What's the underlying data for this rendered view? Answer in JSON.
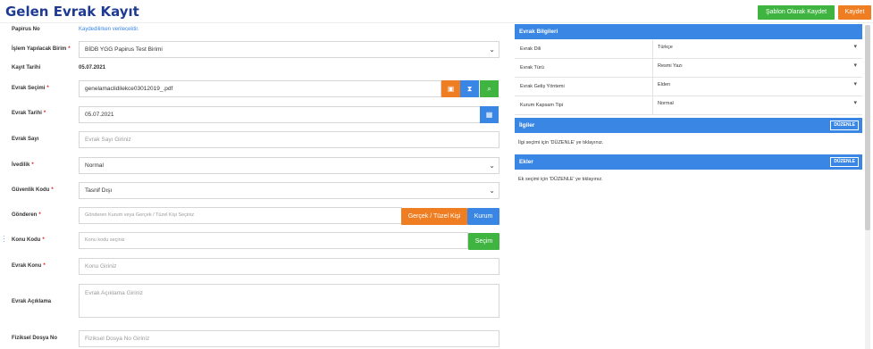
{
  "page": {
    "title": "Gelen Evrak Kayıt"
  },
  "toolbar": {
    "template_label": "Şablon Olarak Kaydet",
    "save_label": "Kaydet"
  },
  "form": {
    "papirus_no": {
      "label": "Papirus No",
      "value": "Kaydedilirken verilecektir."
    },
    "islem_birim": {
      "label": "İşlem Yapılacak Birim",
      "value": "BİDB YGG Papirus Test Birimi"
    },
    "kayit_tarihi": {
      "label": "Kayıt Tarihi",
      "value": "05.07.2021"
    },
    "evrak_secimi": {
      "label": "Evrak Seçimi",
      "value": "genelamaclidilekce03012019_.pdf"
    },
    "evrak_tarihi": {
      "label": "Evrak Tarihi",
      "value": "05.07.2021"
    },
    "evrak_sayi": {
      "label": "Evrak Sayı",
      "placeholder": "Evrak Sayı Giriniz"
    },
    "ivedilik": {
      "label": "İvedilik",
      "value": "Normal"
    },
    "guvenlik": {
      "label": "Güvenlik Kodu",
      "value": "Tasnif Dışı"
    },
    "gonderen": {
      "label": "Gönderen",
      "placeholder": "Gönderen Kurum veya Gerçek / Tüzel Kişi Seçiniz",
      "btn_person": "Gerçek / Tüzel Kişi",
      "btn_org": "Kurum"
    },
    "konu_kodu": {
      "label": "Konu Kodu",
      "placeholder": "Konu kodu seçiniz",
      "btn_select": "Seçim"
    },
    "evrak_konu": {
      "label": "Evrak Konu",
      "placeholder": "Konu Giriniz"
    },
    "evrak_aciklama": {
      "label": "Evrak Açıklama",
      "placeholder": "Evrak Açıklama Giriniz"
    },
    "fiziksel_dosya": {
      "label": "Fiziksel Dosya No",
      "placeholder": "Fiziksel Dosya No Giriniz"
    }
  },
  "panel": {
    "info_title": "Evrak Bilgileri",
    "rows": [
      {
        "label": "Evrak Dili",
        "value": "Türkçe"
      },
      {
        "label": "Evrak Türü",
        "value": "Resmi Yazı"
      },
      {
        "label": "Evrak Geliş Yöntemi",
        "value": "Elden"
      },
      {
        "label": "Kurum Kapsam Tipi",
        "value": "Normal"
      }
    ],
    "ilgiler": {
      "title": "İlgiler",
      "button": "DÜZENLE",
      "note": "İlgi seçimi için 'DÜZENLE' ye tıklayınız."
    },
    "ekler": {
      "title": "Ekler",
      "button": "DÜZENLE",
      "note": "Ek seçimi için 'DÜZENLE' ye tıklayınız."
    }
  },
  "colors": {
    "accent": "#3a86e4",
    "title": "#1f3a93",
    "green": "#3fb441",
    "orange": "#ef7d22"
  }
}
